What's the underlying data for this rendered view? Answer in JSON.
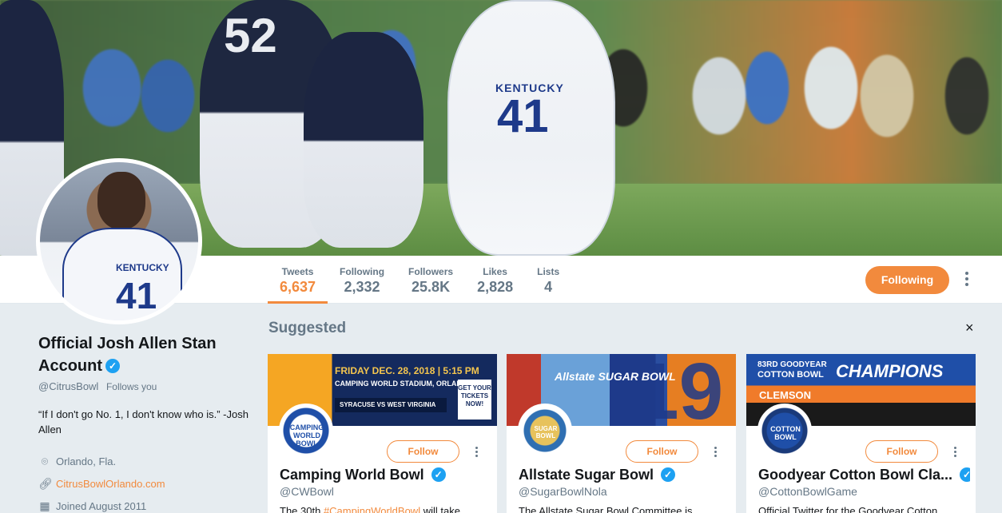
{
  "banner": {
    "player_numbers": [
      "52",
      "41"
    ],
    "jersey_text": "KENTUCKY"
  },
  "nav": {
    "stats": [
      {
        "label": "Tweets",
        "value": "6,637",
        "active": true
      },
      {
        "label": "Following",
        "value": "2,332",
        "active": false
      },
      {
        "label": "Followers",
        "value": "25.8K",
        "active": false
      },
      {
        "label": "Likes",
        "value": "2,828",
        "active": false
      },
      {
        "label": "Lists",
        "value": "4",
        "active": false
      }
    ],
    "following_button": "Following"
  },
  "avatar": {
    "jersey_text": "KENTUCKY",
    "jersey_number": "41"
  },
  "profile": {
    "name": "Official Josh Allen Stan Account",
    "handle": "@CitrusBowl",
    "follows_you": "Follows you",
    "bio": "“If I don't go No. 1, I don't know who is.” -Josh Allen",
    "location": "Orlando, Fla.",
    "website": "CitrusBowlOrlando.com",
    "joined": "Joined August 2011"
  },
  "suggested": {
    "title": "Suggested",
    "close": "×",
    "cards": [
      {
        "name": "Camping World Bowl",
        "handle": "@CWBowl",
        "follow_label": "Follow",
        "desc_prefix": "The 30th ",
        "desc_hashtag": "#CampingWorldBowl",
        "desc_suffix": " will take",
        "banner_lines": [
          "FRIDAY DEC. 28, 2018 | 5:15 PM",
          "CAMPING WORLD STADIUM, ORLANDO",
          "SYRACUSE  VS  WEST VIRGINIA",
          "GET YOUR TICKETS NOW!"
        ],
        "avatar_text": "CAMPING WORLD BOWL"
      },
      {
        "name": "Allstate Sugar Bowl",
        "handle": "@SugarBowlNola",
        "follow_label": "Follow",
        "desc": "The Allstate Sugar Bowl Committee is",
        "banner_lines": [
          "Allstate SUGAR BOWL",
          "19"
        ],
        "avatar_text": "SUGAR BOWL"
      },
      {
        "name": "Goodyear Cotton Bowl Cla...",
        "handle": "@CottonBowlGame",
        "follow_label": "Follow",
        "desc": "Official Twitter for the Goodyear Cotton",
        "banner_lines": [
          "83RD GOODYEAR",
          "COTTON BOWL",
          "CHAMPIONS",
          "CLEMSON"
        ],
        "avatar_text": "COTTON BOWL"
      }
    ]
  },
  "colors": {
    "accent": "#f28a3d",
    "verified": "#1da1f2",
    "muted_text": "#657786",
    "background": "#e6ecf0"
  }
}
